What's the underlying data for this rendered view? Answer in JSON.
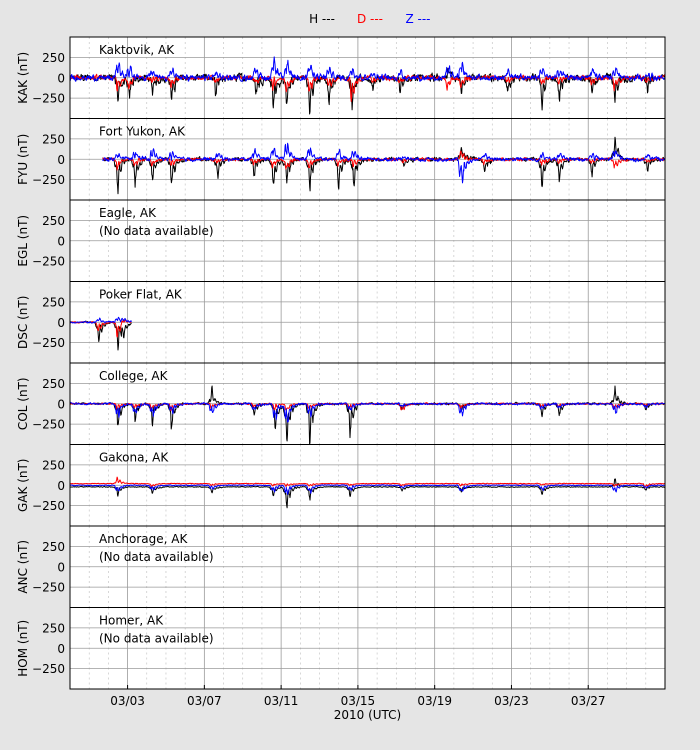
{
  "chart_data": {
    "type": "line",
    "xlabel": "2010 (UTC)",
    "xlim": [
      "2010-02-28",
      "2010-03-31"
    ],
    "x_ticks": [
      {
        "date": "2010-03-03",
        "label": "03/03"
      },
      {
        "date": "2010-03-07",
        "label": "03/07"
      },
      {
        "date": "2010-03-11",
        "label": "03/11"
      },
      {
        "date": "2010-03-15",
        "label": "03/15"
      },
      {
        "date": "2010-03-19",
        "label": "03/19"
      },
      {
        "date": "2010-03-23",
        "label": "03/23"
      },
      {
        "date": "2010-03-27",
        "label": "03/27"
      }
    ],
    "ylim": [
      -500,
      500
    ],
    "y_ticks": [
      250,
      0,
      -250
    ],
    "y_tick_labels": [
      "250",
      "0",
      "−250"
    ],
    "grid": true,
    "legend": {
      "placement": "top-center",
      "entries": [
        {
          "label": "H ---",
          "color": "#000000"
        },
        {
          "label": "D ---",
          "color": "#ff0000"
        },
        {
          "label": "Z ---",
          "color": "#0000ff"
        }
      ]
    },
    "panels": [
      {
        "station": "Kaktovik, AK",
        "ylabel": "KAK (nT)",
        "no_data": false,
        "data_range": [
          "2010-02-28",
          "2010-03-31"
        ],
        "amplitude": {
          "H": 90,
          "D": 55,
          "Z": 70
        },
        "events": [
          {
            "date": "2010-03-02.5",
            "H": -280,
            "D": -200,
            "Z": 250
          },
          {
            "date": "2010-03-03.1",
            "H": -230,
            "D": -120,
            "Z": 180
          },
          {
            "date": "2010-03-04.3",
            "H": -180,
            "D": -60,
            "Z": 110
          },
          {
            "date": "2010-03-05.3",
            "H": -290,
            "D": -120,
            "Z": 120
          },
          {
            "date": "2010-03-07.6",
            "H": -240,
            "D": -60,
            "Z": 90
          },
          {
            "date": "2010-03-09.7",
            "H": -200,
            "D": -80,
            "Z": 150
          },
          {
            "date": "2010-03-10.6",
            "H": -390,
            "D": -150,
            "Z": 280
          },
          {
            "date": "2010-03-11.3",
            "H": -350,
            "D": -200,
            "Z": 250
          },
          {
            "date": "2010-03-12.5",
            "H": -420,
            "D": -180,
            "Z": 200
          },
          {
            "date": "2010-03-13.5",
            "H": -300,
            "D": -120,
            "Z": 150
          },
          {
            "date": "2010-03-14.7",
            "H": -320,
            "D": -330,
            "Z": 180
          },
          {
            "date": "2010-03-15.8",
            "H": -150,
            "D": -60,
            "Z": 90
          },
          {
            "date": "2010-03-17.2",
            "H": -180,
            "D": -80,
            "Z": 80
          },
          {
            "date": "2010-03-19.7",
            "H": 120,
            "D": -130,
            "Z": 180
          },
          {
            "date": "2010-03-20.4",
            "H": -180,
            "D": -120,
            "Z": 260
          },
          {
            "date": "2010-03-22.8",
            "H": -150,
            "D": -80,
            "Z": 120
          },
          {
            "date": "2010-03-24.6",
            "H": -350,
            "D": -120,
            "Z": 150
          },
          {
            "date": "2010-03-25.5",
            "H": -290,
            "D": -60,
            "Z": 120
          },
          {
            "date": "2010-03-27.2",
            "H": -200,
            "D": -80,
            "Z": 100
          },
          {
            "date": "2010-03-28.4",
            "H": -330,
            "D": -150,
            "Z": 150
          },
          {
            "date": "2010-03-30.1",
            "H": -180,
            "D": -60,
            "Z": 80
          }
        ]
      },
      {
        "station": "Fort Yukon, AK",
        "ylabel": "FYU (nT)",
        "no_data": false,
        "data_range": [
          "2010-03-01.7",
          "2010-03-31"
        ],
        "amplitude": {
          "H": 45,
          "D": 35,
          "Z": 45
        },
        "events": [
          {
            "date": "2010-03-02.5",
            "H": -400,
            "D": -120,
            "Z": 100
          },
          {
            "date": "2010-03-03.4",
            "H": -330,
            "D": -100,
            "Z": 120
          },
          {
            "date": "2010-03-04.3",
            "H": -270,
            "D": -80,
            "Z": 150
          },
          {
            "date": "2010-03-05.3",
            "H": -320,
            "D": -100,
            "Z": 120
          },
          {
            "date": "2010-03-07.7",
            "H": -220,
            "D": -60,
            "Z": 100
          },
          {
            "date": "2010-03-09.6",
            "H": -200,
            "D": -80,
            "Z": 150
          },
          {
            "date": "2010-03-10.6",
            "H": -340,
            "D": -120,
            "Z": 180
          },
          {
            "date": "2010-03-11.3",
            "H": -300,
            "D": -150,
            "Z": 250
          },
          {
            "date": "2010-03-12.5",
            "H": -390,
            "D": -120,
            "Z": 200
          },
          {
            "date": "2010-03-14.0",
            "H": -350,
            "D": -80,
            "Z": 120
          },
          {
            "date": "2010-03-14.8",
            "H": -330,
            "D": -100,
            "Z": 150
          },
          {
            "date": "2010-03-17.4",
            "H": -100,
            "D": -40,
            "Z": 60
          },
          {
            "date": "2010-03-20.4",
            "H": 150,
            "D": 120,
            "Z": -420
          },
          {
            "date": "2010-03-21.6",
            "H": -150,
            "D": -60,
            "Z": 100
          },
          {
            "date": "2010-03-24.6",
            "H": -380,
            "D": -80,
            "Z": 100
          },
          {
            "date": "2010-03-25.5",
            "H": -250,
            "D": -60,
            "Z": 80
          },
          {
            "date": "2010-03-27.2",
            "H": -180,
            "D": -50,
            "Z": 80
          },
          {
            "date": "2010-03-28.4",
            "H": 290,
            "D": -120,
            "Z": 150
          },
          {
            "date": "2010-03-30.1",
            "H": -150,
            "D": -50,
            "Z": 80
          }
        ]
      },
      {
        "station": "Eagle, AK",
        "ylabel": "EGL (nT)",
        "no_data": true,
        "no_data_text": "(No data available)"
      },
      {
        "station": "Poker Flat, AK",
        "ylabel": "DSC (nT)",
        "no_data": false,
        "data_range": [
          "2010-02-28",
          "2010-03-03.2"
        ],
        "amplitude": {
          "H": 20,
          "D": 15,
          "Z": 18
        },
        "events": [
          {
            "date": "2010-03-01.5",
            "H": -250,
            "D": -120,
            "Z": 60
          },
          {
            "date": "2010-03-02.5",
            "H": -320,
            "D": -200,
            "Z": 80
          },
          {
            "date": "2010-03-02.8",
            "H": -150,
            "D": 80,
            "Z": 50
          }
        ]
      },
      {
        "station": "College, AK",
        "ylabel": "COL (nT)",
        "no_data": false,
        "data_range": [
          "2010-02-28",
          "2010-03-31"
        ],
        "amplitude": {
          "H": 25,
          "D": 18,
          "Z": 25
        },
        "events": [
          {
            "date": "2010-03-02.5",
            "H": -280,
            "D": -80,
            "Z": -200
          },
          {
            "date": "2010-03-03.4",
            "H": -200,
            "D": -60,
            "Z": -150
          },
          {
            "date": "2010-03-04.3",
            "H": -230,
            "D": -80,
            "Z": -200
          },
          {
            "date": "2010-03-05.3",
            "H": -320,
            "D": -80,
            "Z": -150
          },
          {
            "date": "2010-03-07.4",
            "H": 200,
            "D": -60,
            "Z": -150
          },
          {
            "date": "2010-03-09.6",
            "H": -150,
            "D": -50,
            "Z": -100
          },
          {
            "date": "2010-03-10.7",
            "H": -300,
            "D": -80,
            "Z": -250
          },
          {
            "date": "2010-03-11.3",
            "H": -480,
            "D": -100,
            "Z": -300
          },
          {
            "date": "2010-03-12.5",
            "H": -470,
            "D": -80,
            "Z": -200
          },
          {
            "date": "2010-03-14.6",
            "H": -380,
            "D": -80,
            "Z": -120
          },
          {
            "date": "2010-03-17.3",
            "H": -80,
            "D": -100,
            "Z": -60
          },
          {
            "date": "2010-03-20.4",
            "H": -100,
            "D": -60,
            "Z": -200
          },
          {
            "date": "2010-03-24.6",
            "H": -150,
            "D": -50,
            "Z": -100
          },
          {
            "date": "2010-03-25.5",
            "H": -150,
            "D": -40,
            "Z": -80
          },
          {
            "date": "2010-03-28.4",
            "H": 200,
            "D": -80,
            "Z": -150
          },
          {
            "date": "2010-03-30.0",
            "H": -80,
            "D": -40,
            "Z": -50
          }
        ]
      },
      {
        "station": "Gakona, AK",
        "ylabel": "GAK (nT)",
        "no_data": false,
        "data_range": [
          "2010-02-28",
          "2010-03-31"
        ],
        "amplitude": {
          "H": 10,
          "D": 8,
          "Z": 10
        },
        "offsets": {
          "H": -20,
          "D": 20,
          "Z": 0
        },
        "events": [
          {
            "date": "2010-03-02.5",
            "H": -100,
            "D": 80,
            "Z": -100
          },
          {
            "date": "2010-03-04.3",
            "H": -80,
            "D": -40,
            "Z": -80
          },
          {
            "date": "2010-03-07.4",
            "H": -80,
            "D": -30,
            "Z": -60
          },
          {
            "date": "2010-03-10.6",
            "H": -120,
            "D": -30,
            "Z": -100
          },
          {
            "date": "2010-03-11.3",
            "H": -280,
            "D": -40,
            "Z": -150
          },
          {
            "date": "2010-03-12.5",
            "H": -150,
            "D": -40,
            "Z": -120
          },
          {
            "date": "2010-03-14.6",
            "H": -120,
            "D": -30,
            "Z": -80
          },
          {
            "date": "2010-03-17.3",
            "H": -60,
            "D": -30,
            "Z": -50
          },
          {
            "date": "2010-03-20.4",
            "H": -60,
            "D": -30,
            "Z": -120
          },
          {
            "date": "2010-03-24.6",
            "H": -100,
            "D": -20,
            "Z": -80
          },
          {
            "date": "2010-03-28.4",
            "H": 100,
            "D": -30,
            "Z": -100
          },
          {
            "date": "2010-03-30.0",
            "H": -40,
            "D": -60,
            "Z": -40
          }
        ]
      },
      {
        "station": "Anchorage, AK",
        "ylabel": "ANC (nT)",
        "no_data": true,
        "no_data_text": "(No data available)"
      },
      {
        "station": "Homer, AK",
        "ylabel": "HOM (nT)",
        "no_data": true,
        "no_data_text": "(No data available)"
      }
    ]
  }
}
